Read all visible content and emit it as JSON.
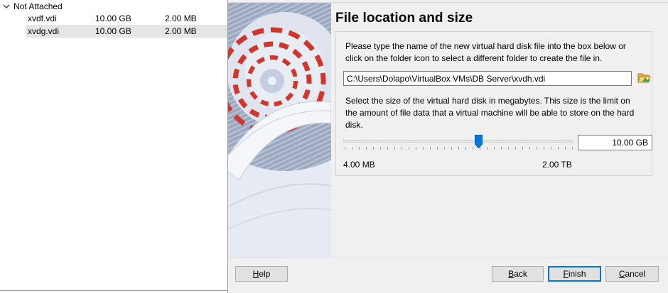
{
  "media_list": {
    "group_label": "Not Attached",
    "rows": [
      {
        "name": "xvdf.vdi",
        "virtual_size": "10.00 GB",
        "actual_size": "2.00 MB",
        "selected": false
      },
      {
        "name": "xvdg.vdi",
        "virtual_size": "10.00 GB",
        "actual_size": "2.00 MB",
        "selected": true
      }
    ]
  },
  "dialog": {
    "title": "File location and size",
    "location_description": "Please type the name of the new virtual hard disk file into the box below or click on the folder icon to select a different folder to create the file in.",
    "path_value": "C:\\Users\\Dolapo\\VirtualBox VMs\\DB Server\\xvdh.vdi",
    "size_description": "Select the size of the virtual hard disk in megabytes. This size is the limit on the amount of file data that a virtual machine will be able to store on the hard disk.",
    "size_value": "10.00 GB",
    "slider_min_label": "4.00 MB",
    "slider_max_label": "2.00 TB",
    "slider_fraction": 0.59,
    "buttons": {
      "help_u": "H",
      "help_rest": "elp",
      "back_u": "B",
      "back_rest": "ack",
      "finish_u": "F",
      "finish_rest": "inish",
      "cancel_u": "C",
      "cancel_rest": "ancel"
    }
  },
  "icons": {
    "group_toggle": "chevron-down-icon",
    "folder": "folder-open-icon",
    "slider_handle": "slider-handle-icon",
    "wizard_art": "hard-disk-illustration"
  },
  "colors": {
    "accent": "#0078d7",
    "illustration_red": "#d2352c",
    "illustration_blue": "#9aa8c4"
  }
}
